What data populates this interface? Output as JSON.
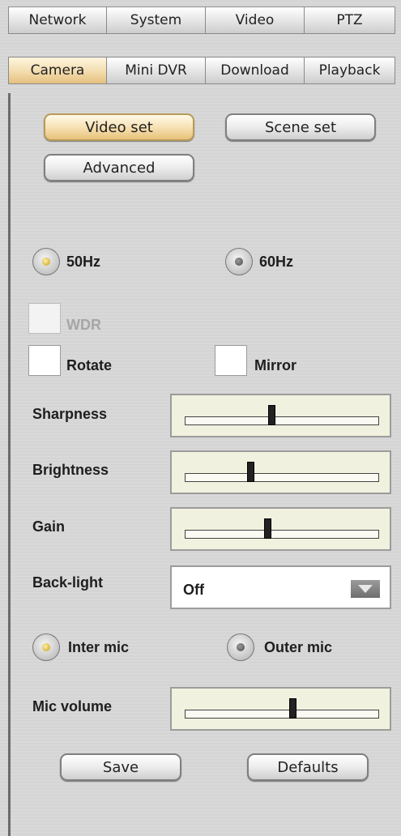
{
  "tabs_row1": [
    "Network",
    "System",
    "Video",
    "PTZ"
  ],
  "tabs_row2": [
    "Camera",
    "Mini DVR",
    "Download",
    "Playback"
  ],
  "active_tab": "Camera",
  "subtabs": {
    "video_set": "Video set",
    "scene_set": "Scene set",
    "advanced": "Advanced",
    "active": "Video set"
  },
  "frequency": {
    "opt1": "50Hz",
    "opt2": "60Hz",
    "selected": "50Hz"
  },
  "options": {
    "wdr": "WDR",
    "rotate": "Rotate",
    "mirror": "Mirror",
    "wdr_disabled": true,
    "rotate_checked": false,
    "mirror_checked": false
  },
  "sliders": {
    "sharpness": {
      "label": "Sharpness",
      "value": 0.45
    },
    "brightness": {
      "label": "Brightness",
      "value": 0.34
    },
    "gain": {
      "label": "Gain",
      "value": 0.43
    },
    "mic_volume": {
      "label": "Mic volume",
      "value": 0.56
    }
  },
  "backlight": {
    "label": "Back-light",
    "value": "Off"
  },
  "mic": {
    "inter": "Inter mic",
    "outer": "Outer mic",
    "selected": "Inter mic"
  },
  "buttons": {
    "save": "Save",
    "defaults": "Defaults"
  },
  "colors": {
    "active_tab": "#f3dcae",
    "panel_bg": "#d8d8d8",
    "slider_bg": "#f1f1df"
  }
}
